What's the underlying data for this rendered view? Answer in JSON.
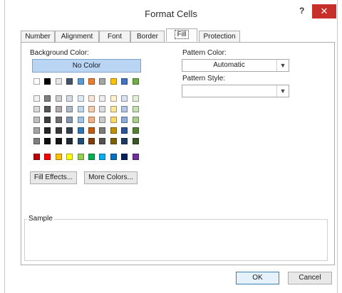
{
  "window": {
    "title": "Format Cells",
    "help_glyph": "?",
    "close_glyph": "✕"
  },
  "tabs": [
    {
      "label": "Number",
      "active": false
    },
    {
      "label": "Alignment",
      "active": false
    },
    {
      "label": "Font",
      "active": false
    },
    {
      "label": "Border",
      "active": false
    },
    {
      "label": "Fill",
      "active": true
    },
    {
      "label": "Protection",
      "active": false
    }
  ],
  "fill": {
    "background_color_label": "Background Color:",
    "no_color_label": "No Color",
    "theme_row": [
      "#ffffff",
      "#000000",
      "#e7e6e6",
      "#44546a",
      "#5b9bd5",
      "#ed7d31",
      "#a5a5a5",
      "#ffc000",
      "#4472c4",
      "#70ad47"
    ],
    "shade_rows": [
      [
        "#f2f2f2",
        "#7f7f7f",
        "#d0cece",
        "#d6dce4",
        "#deebf6",
        "#fbe5d5",
        "#ededed",
        "#fff2cc",
        "#d9e2f3",
        "#e2efd9"
      ],
      [
        "#d8d8d8",
        "#595959",
        "#aeabab",
        "#adb9ca",
        "#bdd7ee",
        "#f7cbac",
        "#dbdbdb",
        "#fee599",
        "#b4c6e7",
        "#c5e0b3"
      ],
      [
        "#bfbfbf",
        "#3f3f3f",
        "#757070",
        "#8496b0",
        "#9dc3e6",
        "#f4b183",
        "#c9c9c9",
        "#ffd965",
        "#8eaadb",
        "#a8d08d"
      ],
      [
        "#a5a5a5",
        "#262626",
        "#3a3838",
        "#323f4f",
        "#2e75b5",
        "#c55a11",
        "#7b7b7b",
        "#bf9000",
        "#2f5496",
        "#538135"
      ],
      [
        "#7f7f7f",
        "#0c0c0c",
        "#171616",
        "#222a35",
        "#1e4e79",
        "#833c0b",
        "#525252",
        "#7f6000",
        "#1f3864",
        "#375623"
      ]
    ],
    "standard_row": [
      "#c00000",
      "#ff0000",
      "#ffc000",
      "#ffff00",
      "#92d050",
      "#00b050",
      "#00b0f0",
      "#0070c0",
      "#002060",
      "#7030a0"
    ],
    "fill_effects_label": "Fill Effects...",
    "more_colors_label": "More Colors...",
    "pattern_color_label": "Pattern Color:",
    "pattern_color_value": "Automatic",
    "pattern_style_label": "Pattern Style:",
    "pattern_style_value": ""
  },
  "sample": {
    "label": "Sample"
  },
  "footer": {
    "ok_label": "OK",
    "cancel_label": "Cancel"
  }
}
